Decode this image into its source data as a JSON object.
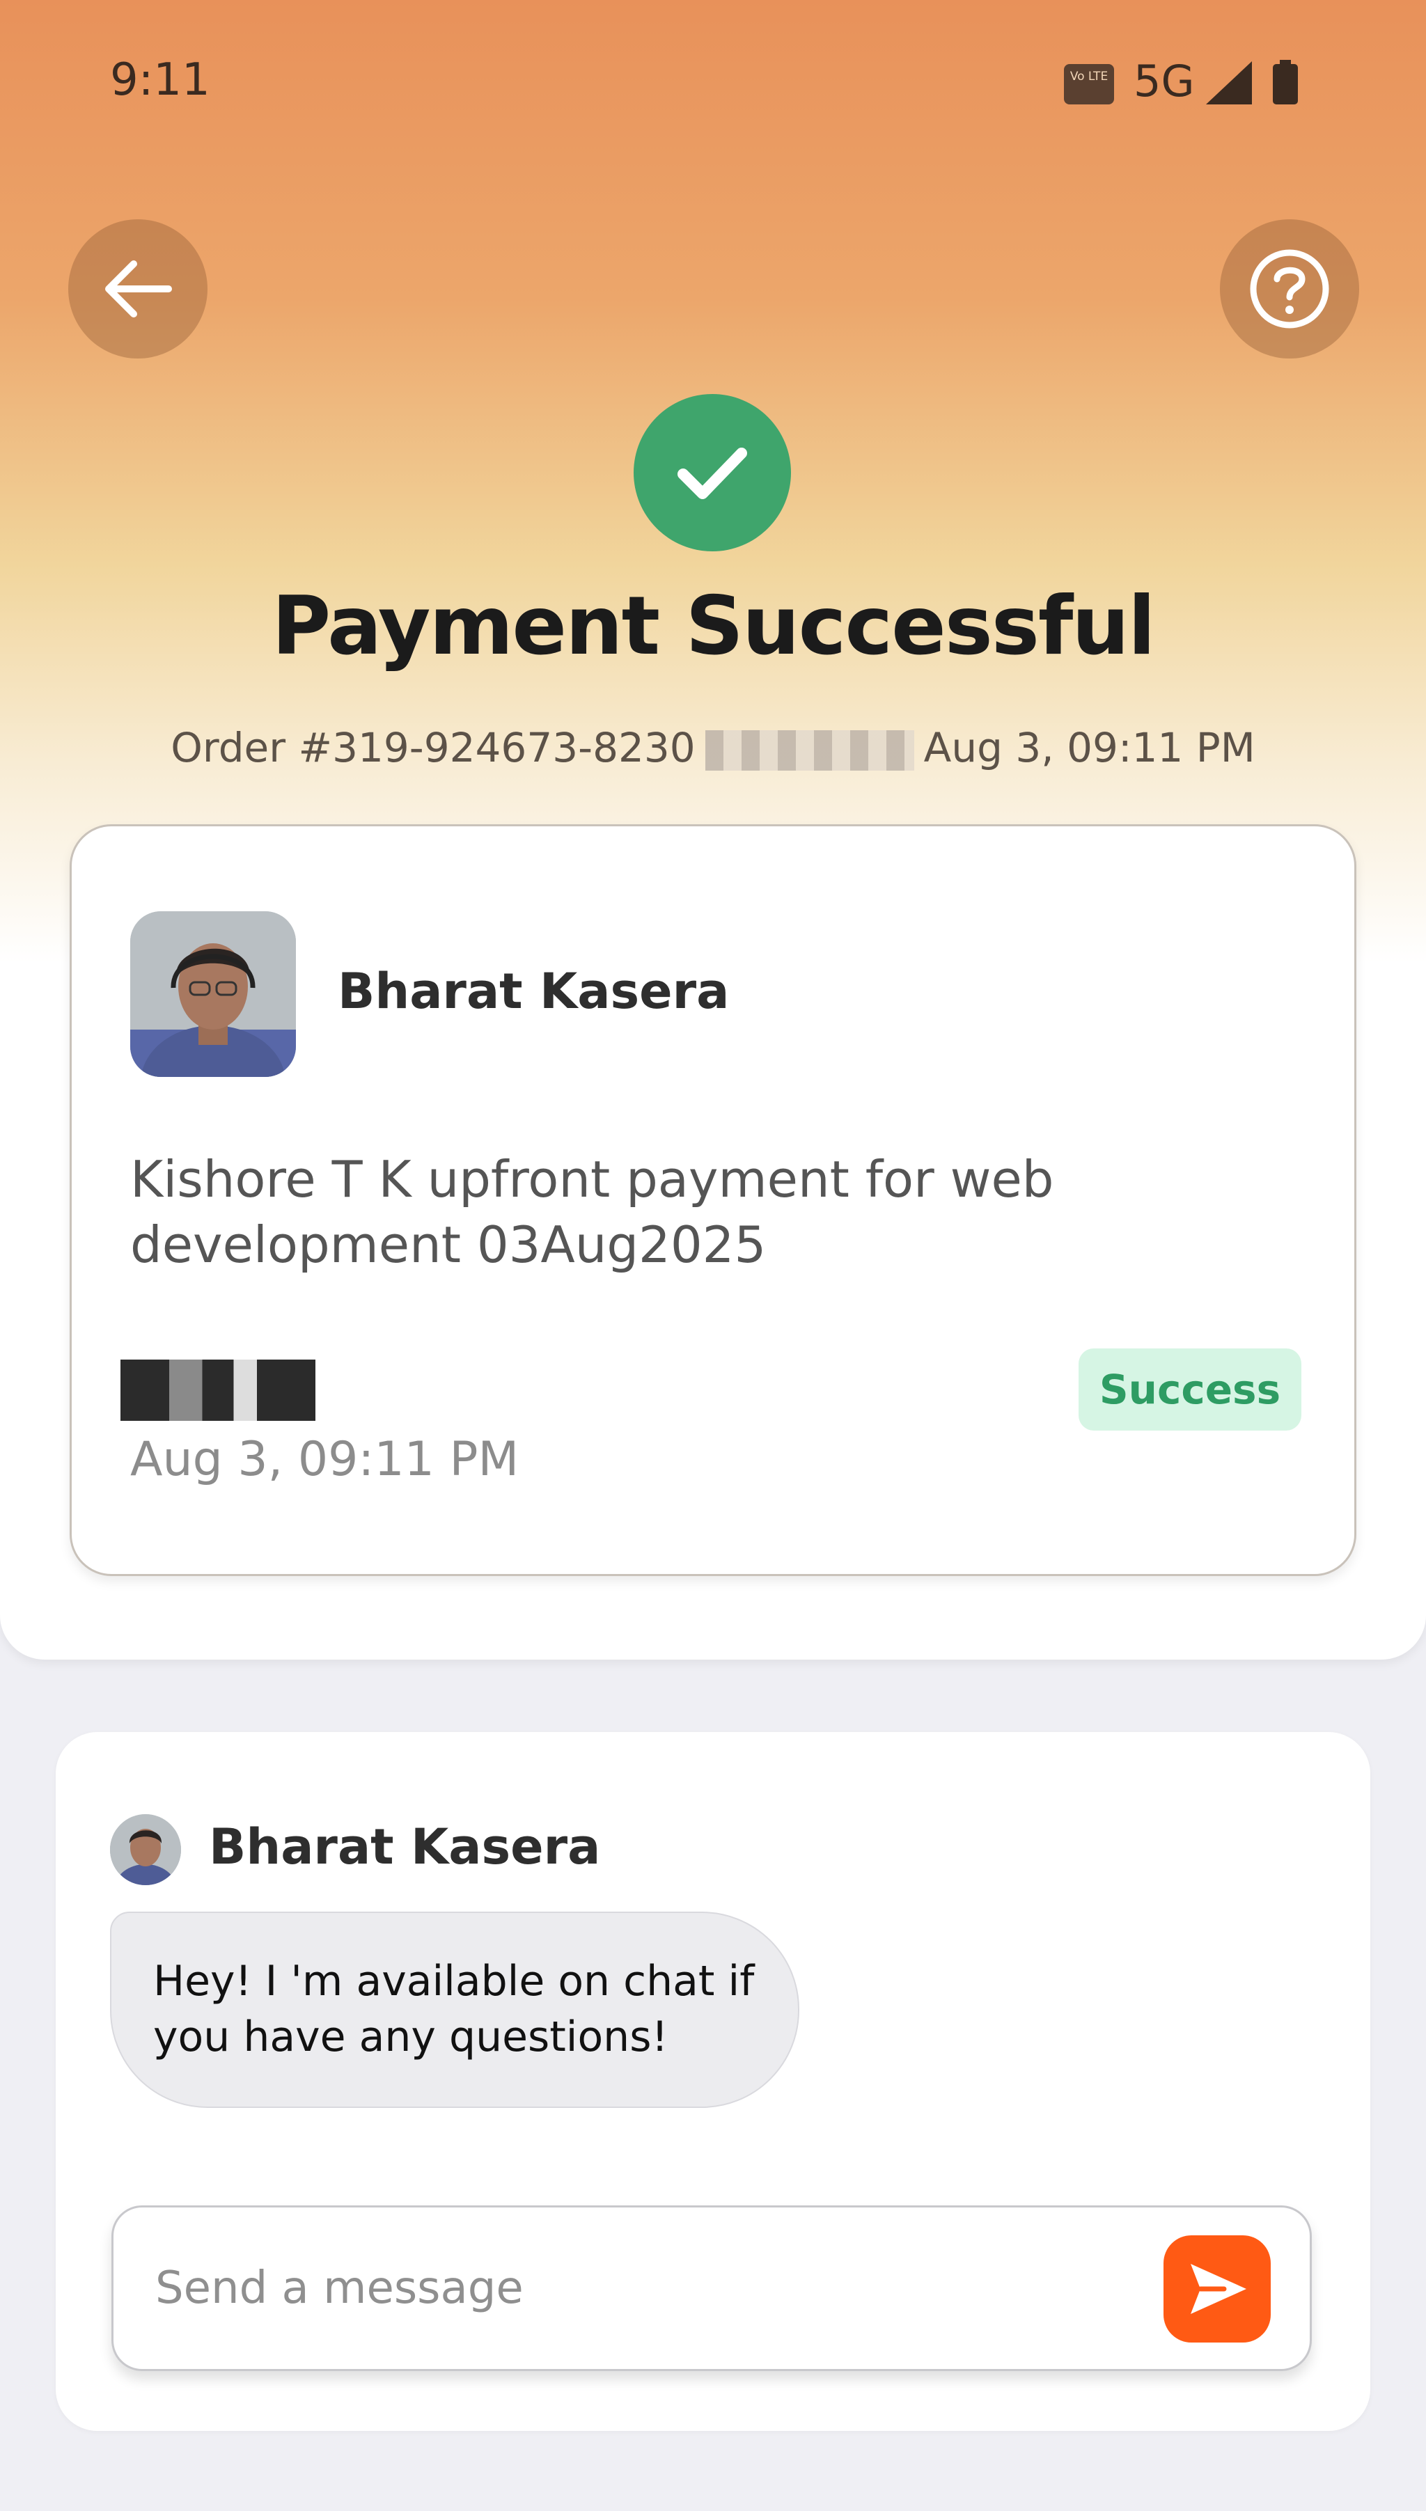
{
  "status_bar": {
    "time": "9:11",
    "volte_label": "Vo LTE",
    "network": "5G",
    "signal_icon": "signal-icon",
    "battery_icon": "battery-icon"
  },
  "header": {
    "back_icon": "arrow-left-icon",
    "help_icon": "help-circle-icon",
    "title": "Payment Successful",
    "order_prefix": "Order #319-924673-8230",
    "order_datetime": "Aug 3, 09:11 PM"
  },
  "payment": {
    "payee_name": "Bharat Kasera",
    "note": "Kishore T K upfront payment for web development 03Aug2025",
    "date": "Aug 3, 09:11 PM",
    "status": "Success"
  },
  "chat": {
    "sender_name": "Bharat Kasera",
    "message": "Hey! I 'm available on chat if you have any questions!",
    "input_placeholder": "Send a message",
    "send_icon": "send-icon"
  },
  "colors": {
    "accent": "#FF5A14",
    "success": "#3FA56C",
    "success_badge_bg": "#D6F5E4",
    "success_badge_text": "#2E9C63"
  }
}
